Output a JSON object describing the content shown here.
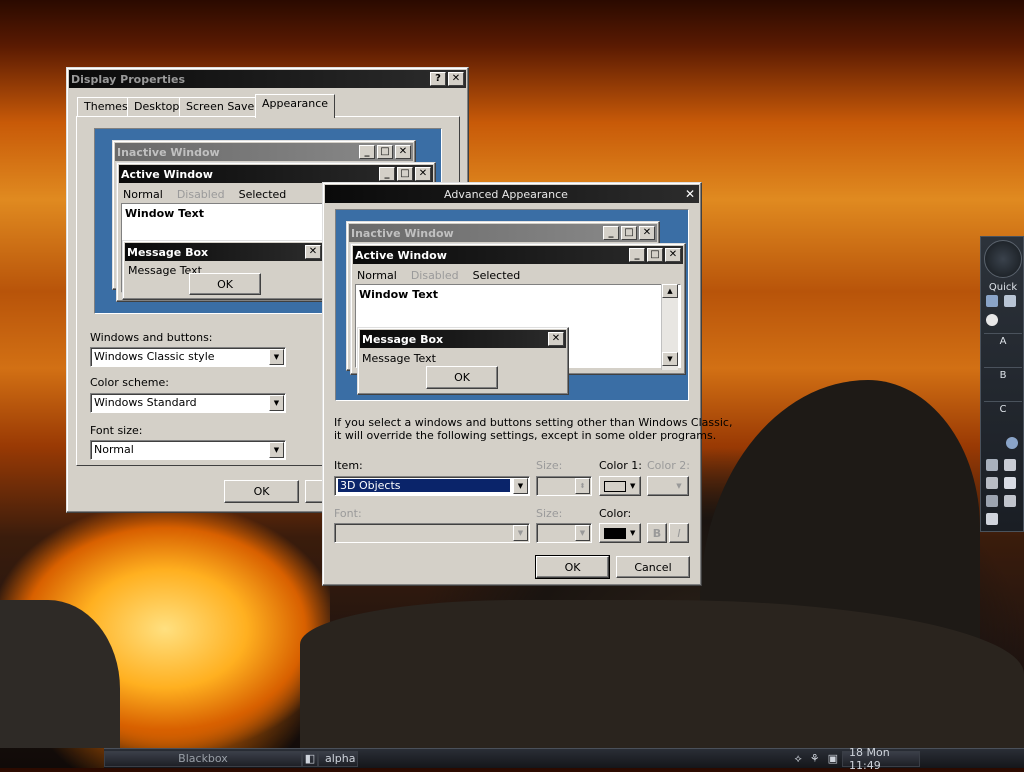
{
  "display_properties": {
    "title": "Display Properties",
    "tabs": [
      "Themes",
      "Desktop",
      "Screen Saver",
      "Appearance"
    ],
    "preview": {
      "inactive_title": "Inactive Window",
      "active_title": "Active Window",
      "menu": [
        "Normal",
        "Disabled",
        "Selected"
      ],
      "window_text": "Window Text",
      "msgbox_title": "Message Box",
      "msgbox_text": "Message Text",
      "msgbox_ok": "OK"
    },
    "windows_buttons_label": "Windows and buttons:",
    "windows_buttons_value": "Windows Classic style",
    "color_scheme_label": "Color scheme:",
    "color_scheme_value": "Windows Standard",
    "font_size_label": "Font size:",
    "font_size_value": "Normal",
    "ok": "OK"
  },
  "advanced": {
    "title": "Advanced Appearance",
    "preview": {
      "inactive_title": "Inactive Window",
      "active_title": "Active Window",
      "menu": [
        "Normal",
        "Disabled",
        "Selected"
      ],
      "window_text": "Window Text",
      "msgbox_title": "Message Box",
      "msgbox_text": "Message Text",
      "msgbox_ok": "OK"
    },
    "info_line1": "If you select a windows and buttons setting other than Windows Classic,",
    "info_line2": "it will override the following settings, except in some older programs.",
    "item_label": "Item:",
    "item_value": "3D Objects",
    "size_label": "Size:",
    "color1_label": "Color 1:",
    "color2_label": "Color 2:",
    "font_label": "Font:",
    "size2_label": "Size:",
    "color_label": "Color:",
    "bold": "B",
    "italic": "I",
    "ok": "OK",
    "cancel": "Cancel"
  },
  "dock": {
    "quick_label": "Quick",
    "rows": [
      "A",
      "B",
      "C"
    ]
  },
  "taskbar": {
    "workspace": "Blackbox",
    "task": "alpha",
    "clock": "18 Mon 11:49"
  },
  "colors": {
    "preview_bg": "#3a6ea5",
    "selection": "#0a246a",
    "face": "#d4d0c8"
  }
}
